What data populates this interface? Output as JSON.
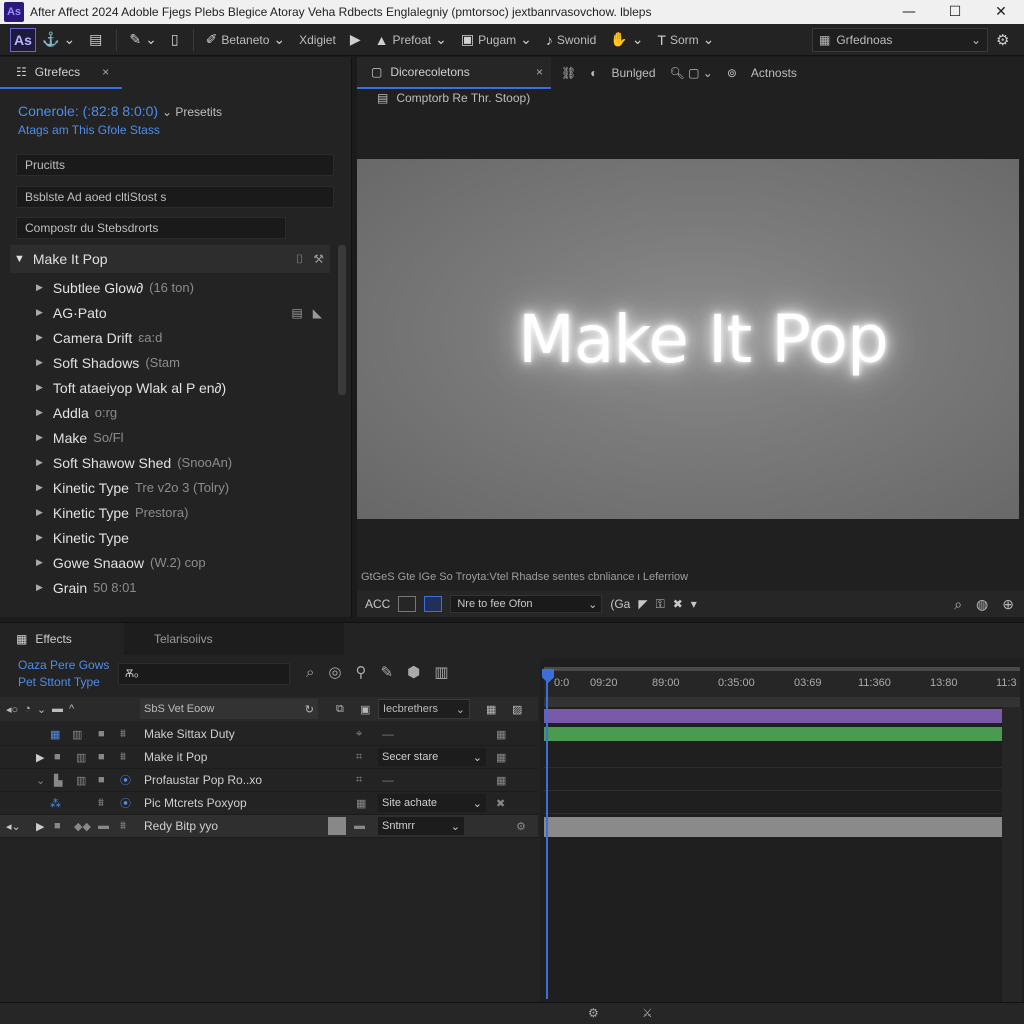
{
  "titlebar": {
    "logo": "As",
    "title": "After Affect 2024  Adoble Fjegs Plebs Blegice Atoray  Veha  Rdbects  Englalegniy (pmtorsoc)  jextbanrvasovchow. lbleps",
    "minimize": "—",
    "maximize": "☐",
    "close": "✕"
  },
  "toolbar": {
    "logo": "As",
    "items": [
      "Betaneto",
      "Xdigiet",
      "Prefoat",
      "Pugam",
      "Swonid",
      "Sorm"
    ],
    "workspace": "Grfednoas"
  },
  "effects_panel": {
    "tab_label": "Gtrefecs",
    "tab_close": "×",
    "heading": "Conerole: (:82:8 8:0:0) ⌄ Presetits",
    "heading_main": "Conerole: (:82:8 8:0:0)",
    "heading_sub": "⌄ Presetits",
    "subheading": "Atags am This Gfole Stass",
    "field1": "Prucitts",
    "field2": "Bsblste Ad aoed cltiStost s",
    "field3": "Compostr du Stebsdrorts",
    "group_title": "Make It Pop",
    "items": [
      {
        "name": "Subtlee  Glow∂",
        "detail": "(16 ton)"
      },
      {
        "name": "AG·Pato",
        "detail": ""
      },
      {
        "name": "Camera Drift",
        "detail": "ɛa:d"
      },
      {
        "name": "Soft Shadows",
        "detail": "(Stam"
      },
      {
        "name": "Toft ataeiyop Wlak al P en∂)",
        "detail": ""
      },
      {
        "name": "Addla",
        "detail": "o:rg"
      },
      {
        "name": "Make",
        "detail": "So/Fl"
      },
      {
        "name": "Soft Shawow Shed",
        "detail": "(SnooAn)"
      },
      {
        "name": "Kinetic Type",
        "detail": "Tre v2o 3  (Tolry)"
      },
      {
        "name": "Kinetic Type",
        "detail": "Prestora)"
      },
      {
        "name": "Kinetic Type",
        "detail": ""
      },
      {
        "name": "Gowe  Snaaow",
        "detail": "(W.2)  cop"
      },
      {
        "name": "Grain",
        "detail": "50 8:01"
      }
    ]
  },
  "comp_panel": {
    "tab_label": "Dicorecoletons",
    "tab_close": "×",
    "tool1": "Bunlged",
    "tool2": "Actnosts",
    "breadcrumb": "Comptorb Re Thr. Stoop)",
    "viewer_text": "Make It Pop",
    "status": "GtGeS Gte IGe  So Troyta:Vtel Rhadse sentes cbnliance ι Leferriow",
    "footer_label": "ACC",
    "footer_select": "Nre to fee Ofon",
    "footer_extra": "(Ga"
  },
  "timeline_panel": {
    "tab_label": "Effects",
    "tab2_label": "Telarisoiivs",
    "head1": "Oaza Pere Gows",
    "head2": "Pet Sttont Type",
    "search_value": "Ѫₒ",
    "col_name": "SbS Vet Eoow",
    "col_mode": "Iecbrethers",
    "layers": [
      {
        "name": "Make Sittax Duty",
        "mode": "—"
      },
      {
        "name": "Make it Pop",
        "mode": "Secer stare"
      },
      {
        "name": "Profaustar Pop Ro..xo",
        "mode": "—"
      },
      {
        "name": "Pic Mtcrets Poxyop",
        "mode": "Site achate"
      },
      {
        "name": "Redy Bitp  yyo",
        "mode": "Sntmrr"
      }
    ],
    "ticks": [
      "0:0",
      "09:20",
      "89:00",
      "0:35:00",
      "03:69",
      "11:360",
      "13:80",
      "11:3"
    ]
  },
  "colors": {
    "accent": "#3d6fd9",
    "link_blue": "#4f8de8",
    "purple_track": "#7a5aa8",
    "green_track": "#4a9a52"
  }
}
